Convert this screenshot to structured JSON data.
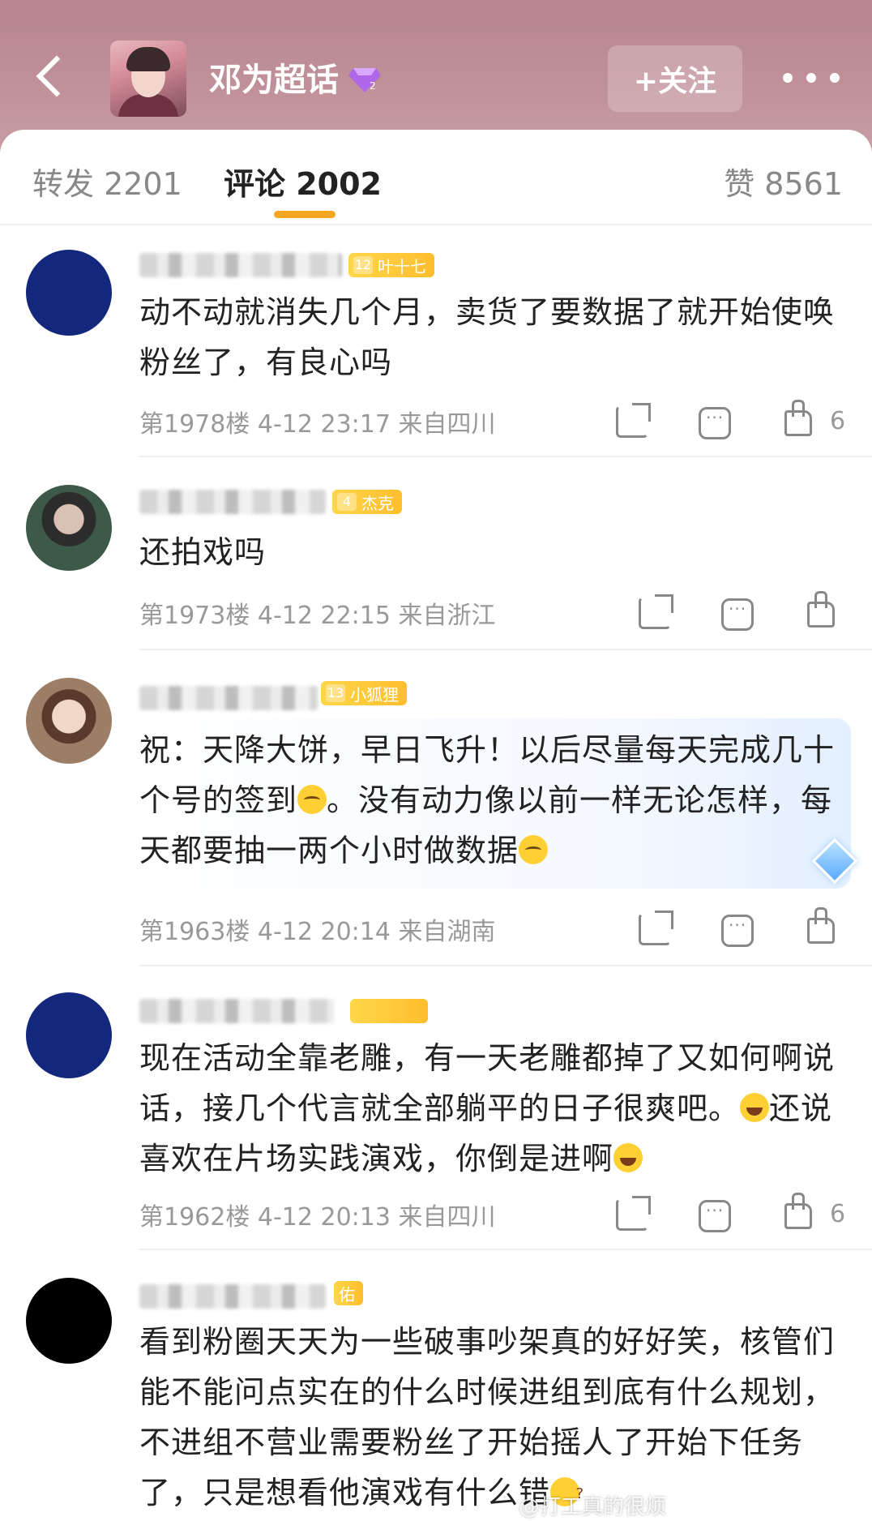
{
  "header": {
    "group_name": "邓为超话",
    "follow_label": "+关注",
    "colors": {
      "header_bg": "#c1919a",
      "accent": "#f6a623"
    }
  },
  "tabs": {
    "forward": "转发 2201",
    "comments": "评论 2002",
    "likes": "赞 8561"
  },
  "comments": [
    {
      "badge_level": "12",
      "badge_name": "叶十七",
      "text": "动不动就消失几个月，卖货了要数据了就开始使唤粉丝了，有良心吗",
      "meta": "第1978楼  4-12 23:17  来自四川",
      "likes": "6"
    },
    {
      "badge_level": "4",
      "badge_name": "杰克",
      "text": "还拍戏吗",
      "meta": "第1973楼  4-12 22:15  来自浙江",
      "likes": ""
    },
    {
      "badge_level": "13",
      "badge_name": "小狐狸",
      "text_a": "祝：天降大饼，早日飞升！以后尽量每天完成几十个号的签到",
      "text_b": "。没有动力像以前一样无论怎样，每天都要抽一两个小时做数据",
      "meta": "第1963楼  4-12 20:14  来自湖南",
      "likes": ""
    },
    {
      "badge_level": "",
      "badge_name": "",
      "text_a": "现在活动全靠老雕，有一天老雕都掉了又如何啊说话，接几个代言就全部躺平的日子很爽吧。",
      "text_b": "还说喜欢在片场实践演戏，你倒是进啊",
      "meta": "第1962楼  4-12 20:13  来自四川",
      "likes": "6"
    },
    {
      "badge_level": "",
      "badge_name": "佑",
      "text": "看到粉圈天天为一些破事吵架真的好好笑，核管们能不能问点实在的什么时候进组到底有什么规划，不进组不营业需要粉丝了开始摇人了开始下任务了，只是想看他演戏有什么错"
    }
  ],
  "watermark": "@打工真的很烦"
}
